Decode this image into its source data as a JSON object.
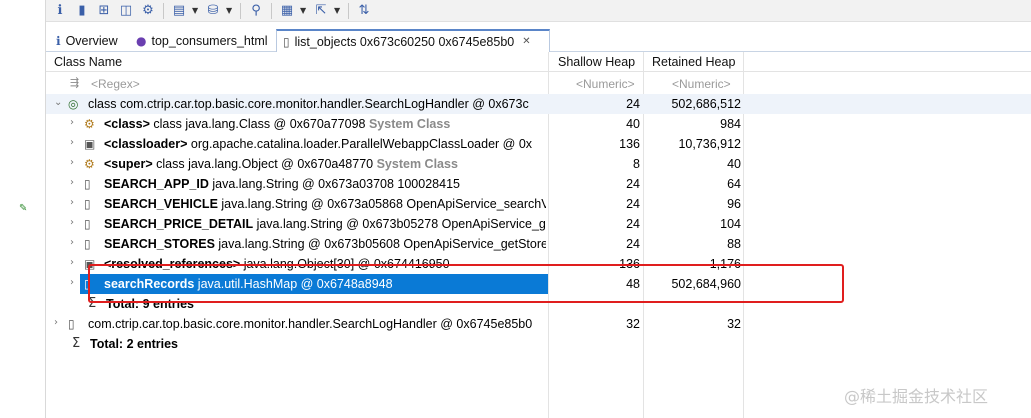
{
  "toolbar": {
    "icons": [
      "info-icon",
      "histogram-icon",
      "dominator-tree-icon",
      "oql-icon",
      "gear-icon",
      "query-browser-icon",
      "dropdown",
      "heap-dump-icon",
      "dropdown",
      "search-icon",
      "grouping-icon",
      "dropdown",
      "export-icon",
      "dropdown",
      "calculate-retained-icon"
    ]
  },
  "tabs": [
    {
      "label": "Overview"
    },
    {
      "label": "top_consumers_html"
    },
    {
      "label": "list_objects  0x673c60250 0x6745e85b0"
    }
  ],
  "table": {
    "columns": {
      "class_name": "Class Name",
      "shallow": "Shallow Heap",
      "retained": "Retained Heap"
    },
    "filters": {
      "class_name": "<Regex>",
      "shallow": "<Numeric>",
      "retained": "<Numeric>"
    },
    "rows": [
      {
        "name": "class com.ctrip.car.top.basic.core.monitor.handler.SearchLogHandler @ 0x673c",
        "shallow": "24",
        "retained": "502,686,512"
      },
      {
        "field": "<class>",
        "rest": " class java.lang.Class @ 0x670a77098 ",
        "tag": "System Class",
        "shallow": "40",
        "retained": "984"
      },
      {
        "field": "<classloader>",
        "rest": " org.apache.catalina.loader.ParallelWebappClassLoader @ 0x",
        "shallow": "136",
        "retained": "10,736,912"
      },
      {
        "field": "<super>",
        "rest": " class java.lang.Object @ 0x670a48770 ",
        "tag": "System Class",
        "shallow": "8",
        "retained": "40"
      },
      {
        "field": "SEARCH_APP_ID",
        "rest": " java.lang.String @ 0x673a03708  100028415",
        "shallow": "24",
        "retained": "64"
      },
      {
        "field": "SEARCH_VEHICLE",
        "rest": " java.lang.String @ 0x673a05868  OpenApiService_searchV",
        "shallow": "24",
        "retained": "96"
      },
      {
        "field": "SEARCH_PRICE_DETAIL",
        "rest": " java.lang.String @ 0x673b05278  OpenApiService_ge",
        "shallow": "24",
        "retained": "104"
      },
      {
        "field": "SEARCH_STORES",
        "rest": " java.lang.String @ 0x673b05608  OpenApiService_getStore",
        "shallow": "24",
        "retained": "88"
      },
      {
        "field": "<resolved_references>",
        "rest": " java.lang.Object[30] @ 0x674416950",
        "shallow": "136",
        "retained": "1,176"
      },
      {
        "field": "searchRecords",
        "rest": " java.util.HashMap @ 0x6748a8948",
        "shallow": "48",
        "retained": "502,684,960"
      },
      {
        "total": "Total: 9 entries"
      },
      {
        "name": "com.ctrip.car.top.basic.core.monitor.handler.SearchLogHandler @ 0x6745e85b0",
        "shallow": "32",
        "retained": "32"
      },
      {
        "total": "Total: 2 entries"
      }
    ]
  },
  "watermark": "@稀土掘金技术社区",
  "colors": {
    "selection": "#0a7ad6",
    "highlight_box": "#e01e1e"
  }
}
